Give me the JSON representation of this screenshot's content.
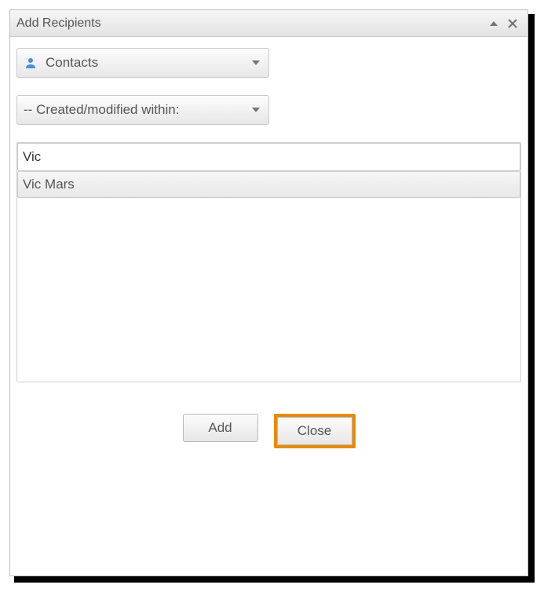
{
  "dialog": {
    "title": "Add Recipients"
  },
  "dropdowns": {
    "source": {
      "label": "Contacts"
    },
    "filter": {
      "label": "-- Created/modified within:"
    }
  },
  "search": {
    "value": "Vic",
    "placeholder": ""
  },
  "results": [
    {
      "name": "Vic Mars"
    }
  ],
  "buttons": {
    "add": "Add",
    "close": "Close"
  }
}
